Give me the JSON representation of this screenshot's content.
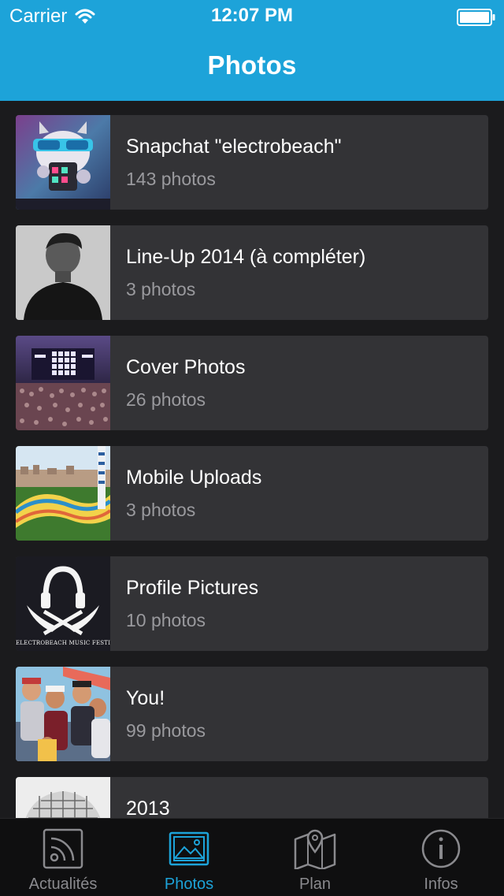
{
  "status_bar": {
    "carrier": "Carrier",
    "time": "12:07 PM",
    "wifi_icon": "wifi-icon",
    "battery_icon": "battery-icon"
  },
  "header": {
    "title": "Photos",
    "background_color": "#1da3d9"
  },
  "albums": [
    {
      "name": "Snapchat \"electrobeach\"",
      "count": "143 photos",
      "thumb": "snapchat-thumbnail"
    },
    {
      "name": "Line-Up 2014 (à compléter)",
      "count": "3 photos",
      "thumb": "lineup-thumbnail"
    },
    {
      "name": "Cover Photos",
      "count": "26 photos",
      "thumb": "concert-crowd-thumbnail"
    },
    {
      "name": "Mobile Uploads",
      "count": "3 photos",
      "thumb": "park-mosaic-thumbnail"
    },
    {
      "name": "Profile Pictures",
      "count": "10 photos",
      "thumb": "festival-logo-thumbnail",
      "logo_text": "ELECTROBEACH MUSIC FESTIVAL"
    },
    {
      "name": "You!",
      "count": "99 photos",
      "thumb": "group-photo-thumbnail"
    },
    {
      "name": "2013",
      "count": "",
      "thumb": "building-thumbnail"
    }
  ],
  "tab_bar": {
    "active_color": "#1da3d9",
    "items": [
      {
        "label": "Actualités",
        "icon": "rss-icon",
        "active": false
      },
      {
        "label": "Photos",
        "icon": "photo-icon",
        "active": true
      },
      {
        "label": "Plan",
        "icon": "map-icon",
        "active": false
      },
      {
        "label": "Infos",
        "icon": "info-icon",
        "active": false
      }
    ]
  }
}
